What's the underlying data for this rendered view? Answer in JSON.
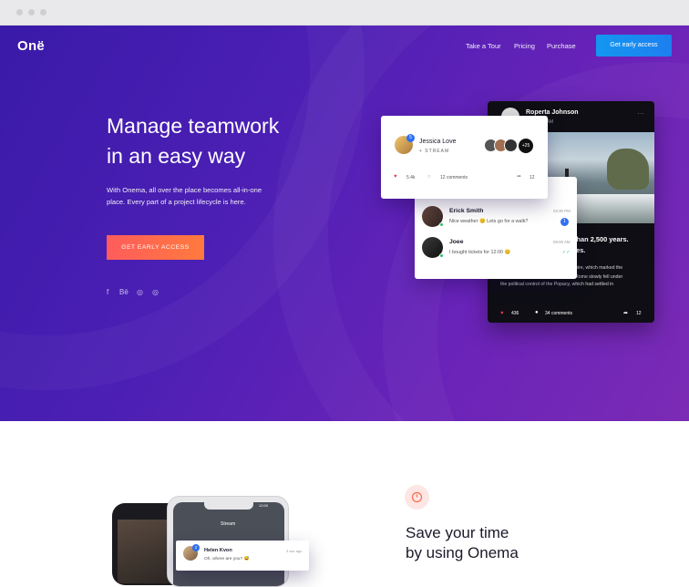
{
  "browser": {
    "dots": 3
  },
  "header": {
    "logo": "Onë",
    "nav": [
      "Take a Tour",
      "Pricing",
      "Purchase"
    ],
    "cta": "Get early access"
  },
  "hero": {
    "title_line1": "Manage teamwork",
    "title_line2": "in an easy way",
    "desc_line1": "With Onema, all over the place becomes all-in-one",
    "desc_line2": "place. Every part of a project lifecycle is here.",
    "cta": "GET EARLY ACCESS",
    "social": [
      "f",
      "Bē",
      "◎",
      "◎"
    ]
  },
  "post_card": {
    "name": "Jessica Love",
    "sub": "+ STREAM",
    "badge": "5",
    "extra_members": "+25",
    "likes": "5.4k",
    "comments": "12 comments",
    "shares": "12"
  },
  "chat_card": {
    "items": [
      {
        "name": "Erick Smith",
        "time": "03:30 PM",
        "msg": "Nice weather 😊 Lets go for a walk?",
        "badge": "1"
      },
      {
        "name": "Joee",
        "time": "09:00 AM",
        "msg": "I bought tickets for 12:00 😊",
        "badge": "✓✓"
      }
    ]
  },
  "dark_card": {
    "name": "Roperta Johnson",
    "time": "30 AM",
    "headline1": "re than 2,500 years.",
    "headline2": "dates.",
    "body1": "pire, which marked the",
    "body2": "Rome slowly fell under",
    "body3": "the political control of the Popacy, which had settled in",
    "likes": "436",
    "comments": "34 comments",
    "shares": "12"
  },
  "feature": {
    "title_line1": "Save your time",
    "title_line2": "by using Onema",
    "phone_header": "Stream",
    "phone_time": "12:00",
    "phone_item_name": "Helen Kvon",
    "phone_item_time": "3 sec ago",
    "phone_item_msg": "Oh, where are you? 😅",
    "phone_badge": "2"
  },
  "colors": {
    "hero_start": "#3a1aa8",
    "hero_end": "#7b2bb5",
    "accent_blue": "#1d7ff0",
    "accent_orange": "#ff6a4a",
    "dark_text": "#1a1a2a"
  }
}
